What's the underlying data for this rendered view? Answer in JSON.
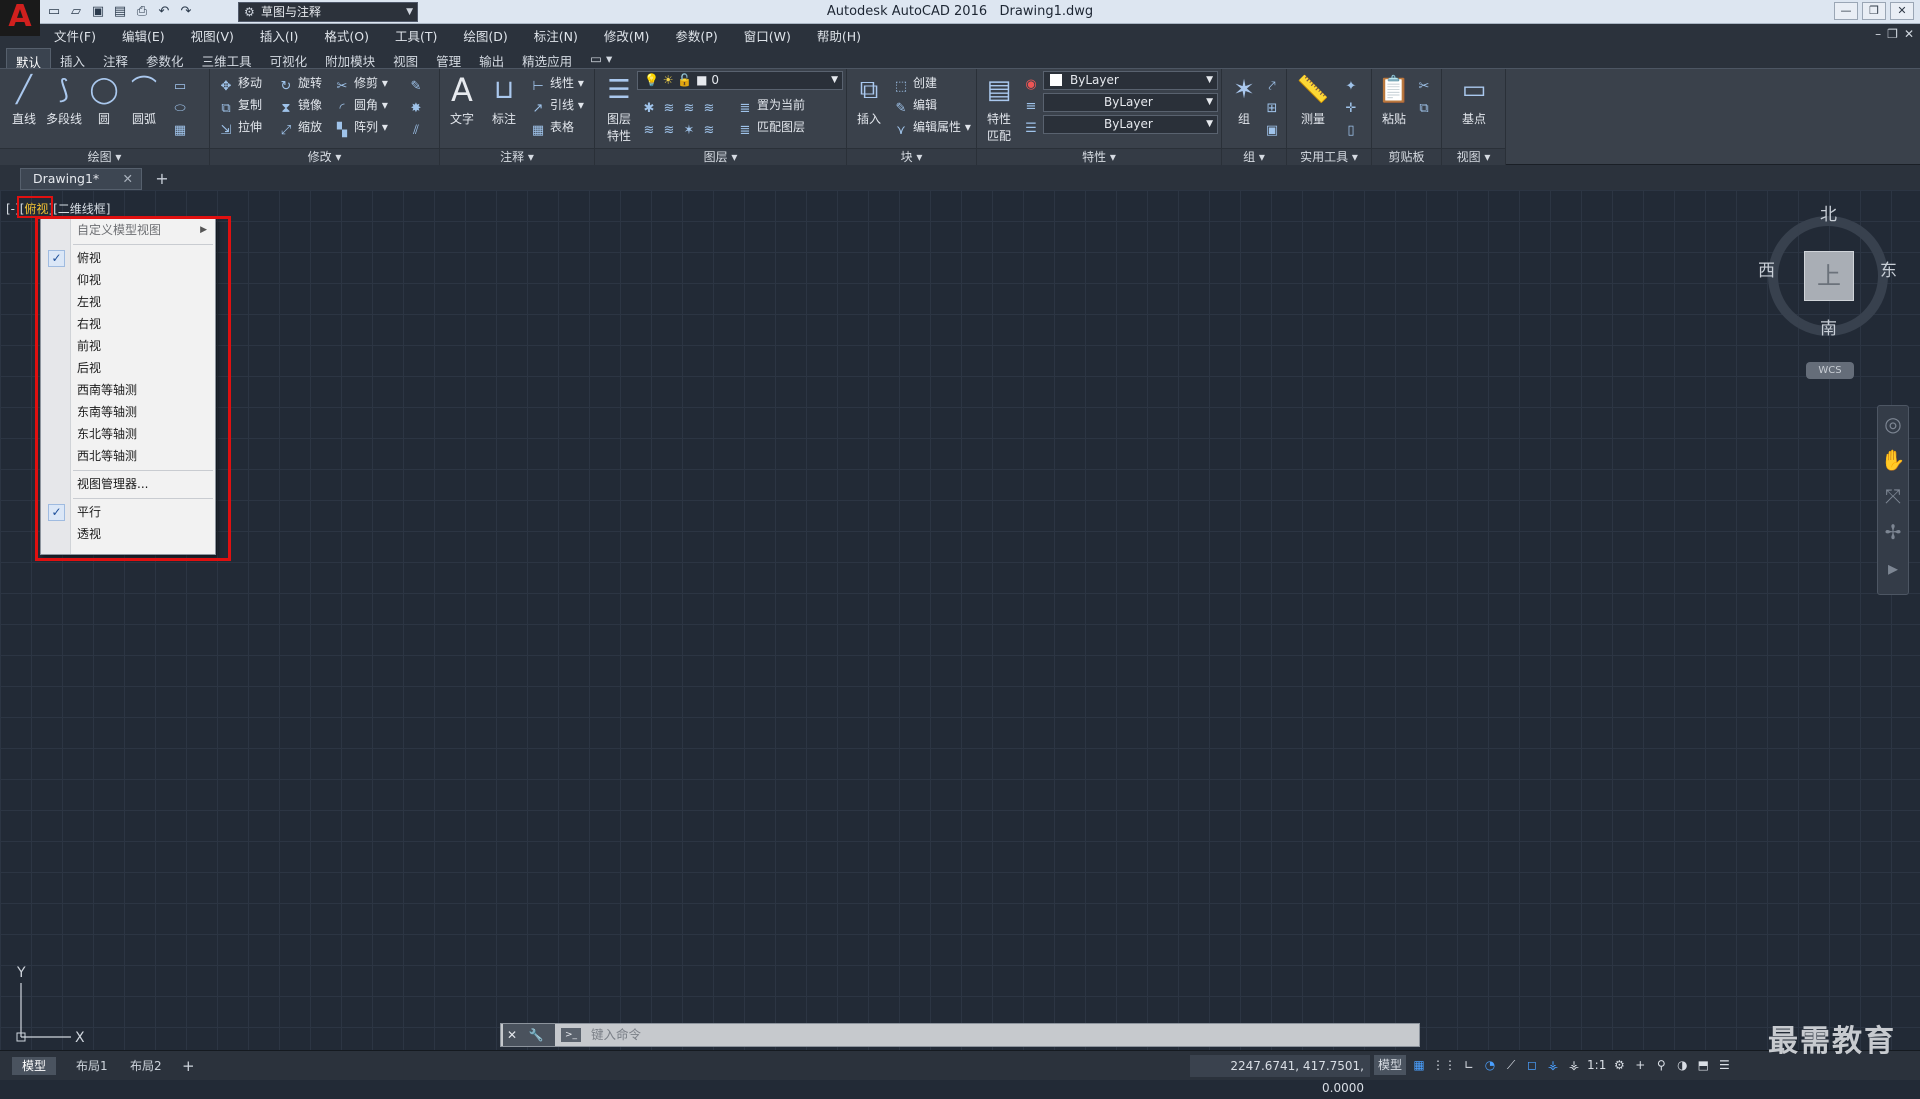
{
  "titlebar": {
    "app_title": "Autodesk AutoCAD 2016",
    "doc_title": "Drawing1.dwg",
    "workspace": "草图与注释",
    "app_logo": "A"
  },
  "menubar": [
    "文件(F)",
    "编辑(E)",
    "视图(V)",
    "插入(I)",
    "格式(O)",
    "工具(T)",
    "绘图(D)",
    "标注(N)",
    "修改(M)",
    "参数(P)",
    "窗口(W)",
    "帮助(H)"
  ],
  "ribbon_tabs": [
    "默认",
    "插入",
    "注释",
    "参数化",
    "三维工具",
    "可视化",
    "附加模块",
    "视图",
    "管理",
    "输出",
    "精选应用"
  ],
  "ribbon": {
    "draw": {
      "title": "绘图",
      "line": "直线",
      "polyline": "多段线",
      "circle": "圆",
      "arc": "圆弧"
    },
    "modify": {
      "title": "修改",
      "move": "移动",
      "rotate": "旋转",
      "trim": "修剪",
      "copy": "复制",
      "mirror": "镜像",
      "fillet": "圆角",
      "stretch": "拉伸",
      "scale": "缩放",
      "array": "阵列"
    },
    "annotation": {
      "title": "注释",
      "text": "文字",
      "dim": "标注",
      "linear": "线性",
      "leader": "引线",
      "table": "表格"
    },
    "layers": {
      "title": "图层",
      "props": "图层\n特性",
      "current_layer": "0",
      "make_current": "置为当前",
      "match_layer": "匹配图层"
    },
    "block": {
      "title": "块",
      "insert": "插入",
      "create": "创建",
      "edit": "编辑",
      "edit_attr": "编辑属性"
    },
    "properties": {
      "title": "特性",
      "match": "特性\n匹配",
      "color": "ByLayer",
      "linetype": "ByLayer",
      "lineweight": "ByLayer"
    },
    "groups": {
      "title": "组",
      "group": "组"
    },
    "utilities": {
      "title": "实用工具",
      "measure": "测量"
    },
    "clipboard": {
      "title": "剪贴板",
      "paste": "粘贴"
    },
    "view": {
      "title": "视图",
      "base": "基点"
    }
  },
  "doc_tab": {
    "name": "Drawing1*"
  },
  "viewport_controls": {
    "prefix": "[-][",
    "view": "俯视",
    "mid": "][",
    "style": "二维线框",
    "suffix": "]"
  },
  "context_menu": {
    "items": [
      {
        "label": "自定义模型视图",
        "type": "submenu",
        "dim": true
      },
      {
        "label": "俯视",
        "checked": true
      },
      {
        "label": "仰视"
      },
      {
        "label": "左视"
      },
      {
        "label": "右视"
      },
      {
        "label": "前视"
      },
      {
        "label": "后视"
      },
      {
        "label": "西南等轴测"
      },
      {
        "label": "东南等轴测"
      },
      {
        "label": "东北等轴测"
      },
      {
        "label": "西北等轴测"
      },
      {
        "label": "视图管理器..."
      },
      {
        "label": "平行",
        "checked": true
      },
      {
        "label": "透视"
      }
    ]
  },
  "viewcube": {
    "north": "北",
    "south": "南",
    "east": "东",
    "west": "西",
    "face": "上",
    "wcs": "WCS"
  },
  "ucs": {
    "x": "X",
    "y": "Y"
  },
  "command_line": {
    "placeholder": "键入命令"
  },
  "layout_tabs": [
    "模型",
    "布局1",
    "布局2"
  ],
  "status": {
    "coords": "2247.6741, 417.7501, 0.0000",
    "model": "模型",
    "scale": "1:1"
  },
  "watermark": "最需教育",
  "colors": {
    "canvas": "#222a36",
    "ribbon": "#3a414b",
    "highlight": "#e01010",
    "accent": "#4aa0ff"
  }
}
